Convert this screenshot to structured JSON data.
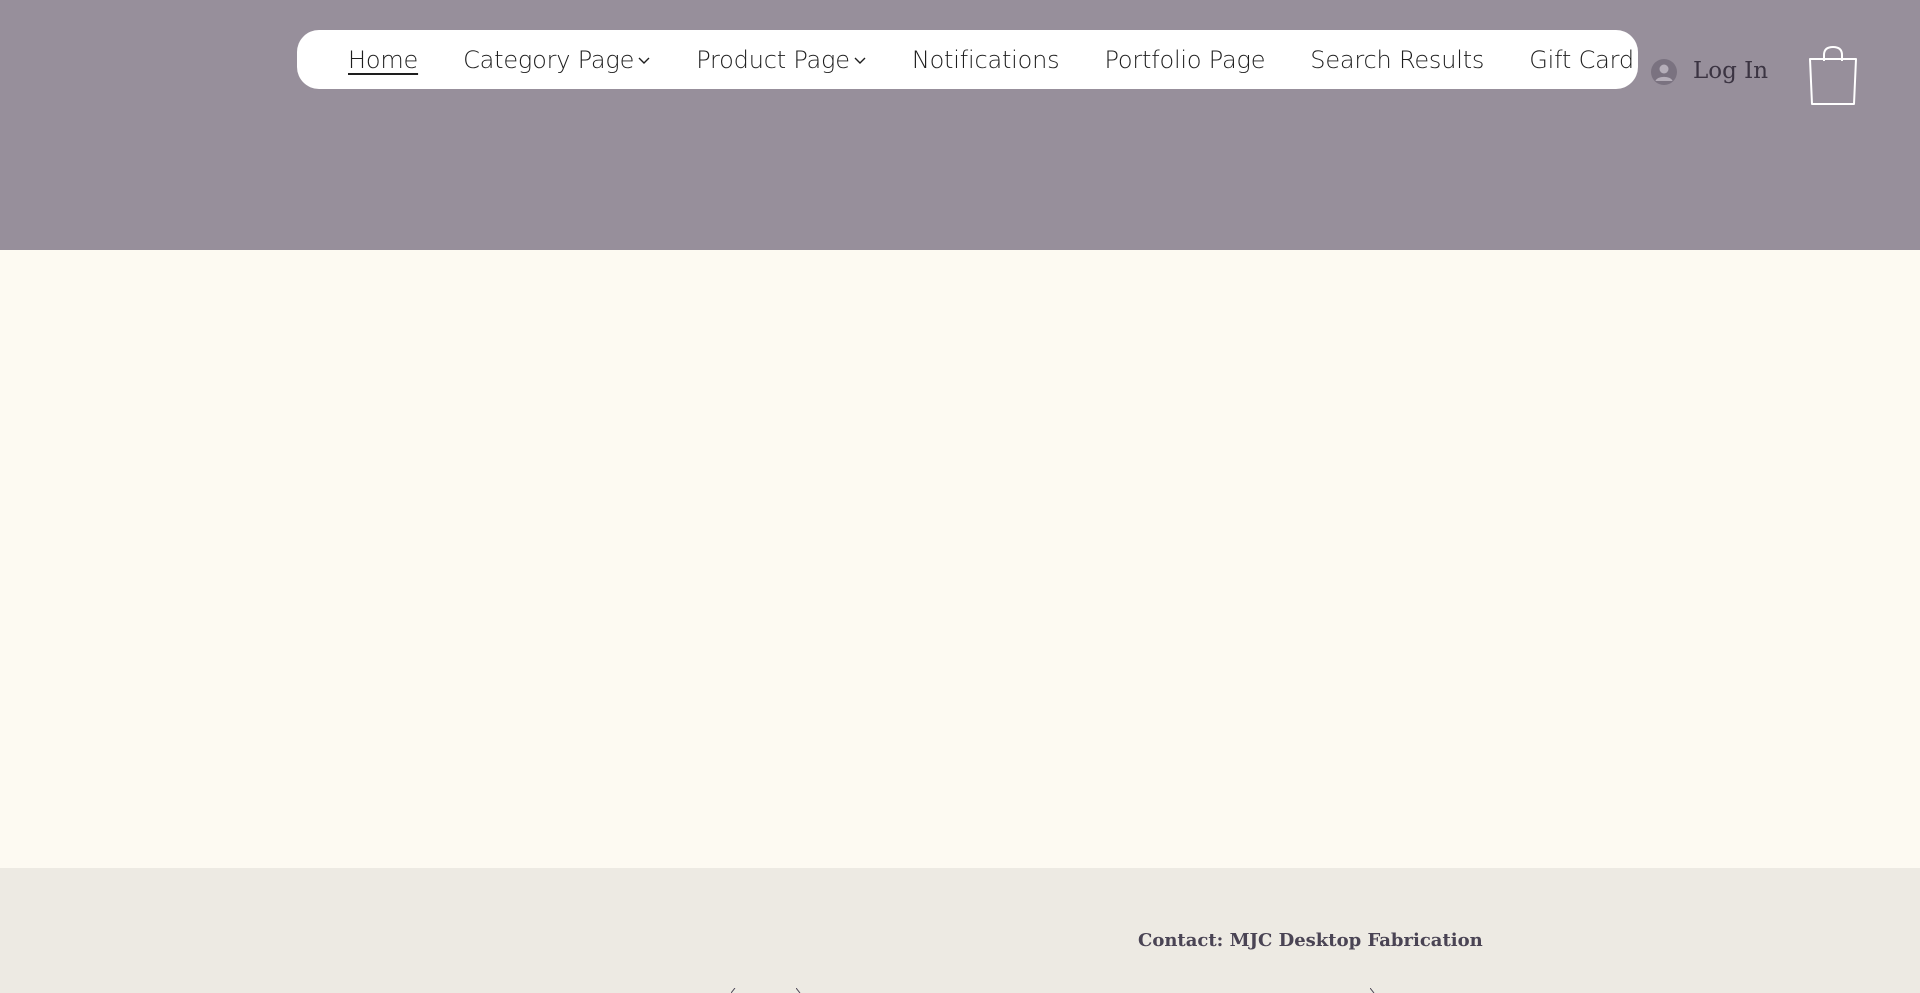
{
  "nav": {
    "items": [
      {
        "label": "Home",
        "active": true,
        "dropdown": false
      },
      {
        "label": "Category Page",
        "active": false,
        "dropdown": true
      },
      {
        "label": "Product Page",
        "active": false,
        "dropdown": true
      },
      {
        "label": "Notifications",
        "active": false,
        "dropdown": false
      },
      {
        "label": "Portfolio Page",
        "active": false,
        "dropdown": false
      },
      {
        "label": "Search Results",
        "active": false,
        "dropdown": false
      },
      {
        "label": "Gift Card",
        "active": false,
        "dropdown": false
      }
    ]
  },
  "account": {
    "login_label": "Log In",
    "avatar_icon": "user-avatar-icon"
  },
  "cart": {
    "icon": "shopping-bag-icon"
  },
  "footer": {
    "contact_text": "Contact: MJC Desktop Fabrication"
  },
  "colors": {
    "header_bg": "#978f9b",
    "page_bg": "#fdfaf2",
    "footer_bg": "#edeae3",
    "nav_bg": "#ffffff"
  }
}
